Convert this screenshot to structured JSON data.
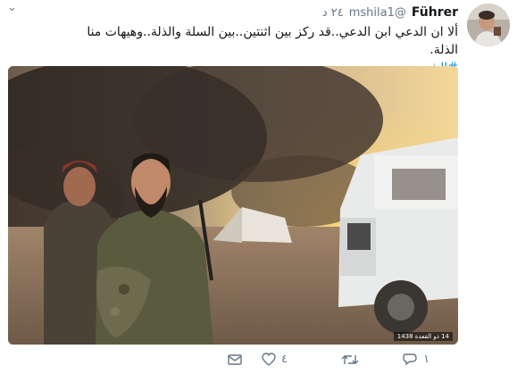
{
  "tweet": {
    "display_name": "Führer",
    "handle": "@mshila1",
    "time": "٢٤ د",
    "text": "ألا ان الدعي ابن الدعي..قد ركز بين اثنتين..بين السلة والذلة..وهيهات منا الذلة.",
    "hashtag": "#الشهيد_محسن_حججي",
    "image_watermark": "14 ذو القعدة 1438",
    "stats": {
      "replies": "١",
      "retweets": "",
      "likes": "٤"
    }
  },
  "icons": {
    "caret": "chevron-down-icon",
    "reply": "reply-icon",
    "retweet": "retweet-icon",
    "like": "heart-icon",
    "dm": "envelope-icon"
  },
  "colors": {
    "link": "#1b95e0",
    "secondary_text": "#657786"
  }
}
